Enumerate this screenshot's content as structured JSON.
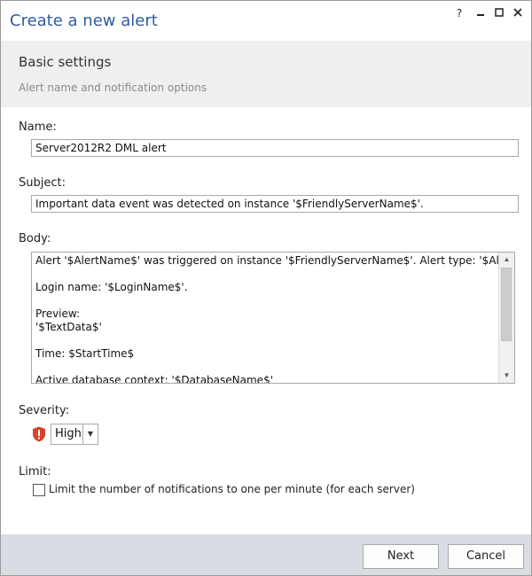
{
  "window": {
    "title": "Create a new alert",
    "controls": [
      "?",
      "✕",
      "▁",
      "☐",
      "✕"
    ]
  },
  "header": {
    "title": "Basic settings",
    "subtitle": "Alert name and notification options"
  },
  "form": {
    "name": {
      "label": "Name:",
      "value": "Server2012R2 DML alert"
    },
    "subject": {
      "label": "Subject:",
      "value": "Important data event was detected on instance '$FriendlyServerName$'."
    },
    "body": {
      "label": "Body:",
      "lines": [
        "Alert '$AlertName$' was triggered on instance '$FriendlyServerName$'. Alert type: '$AlertType$'",
        "",
        "Login name: '$LoginName$'.",
        "",
        "Preview:",
        "'$TextData$'",
        "",
        "Time: $StartTime$",
        "",
        "Active database context: '$DatabaseName$'"
      ]
    },
    "severity": {
      "label": "Severity:",
      "value": "High",
      "icon": "shield-warning-icon",
      "color": "#d9412b"
    },
    "limit": {
      "label": "Limit:",
      "checkbox_label": "Limit the number of notifications to one per minute (for each server)",
      "checked": false
    }
  },
  "footer": {
    "next_label": "Next",
    "cancel_label": "Cancel"
  },
  "colors": {
    "title": "#2f5b9b",
    "header_bg": "#efefef",
    "footer_bg": "#d9dde3"
  }
}
